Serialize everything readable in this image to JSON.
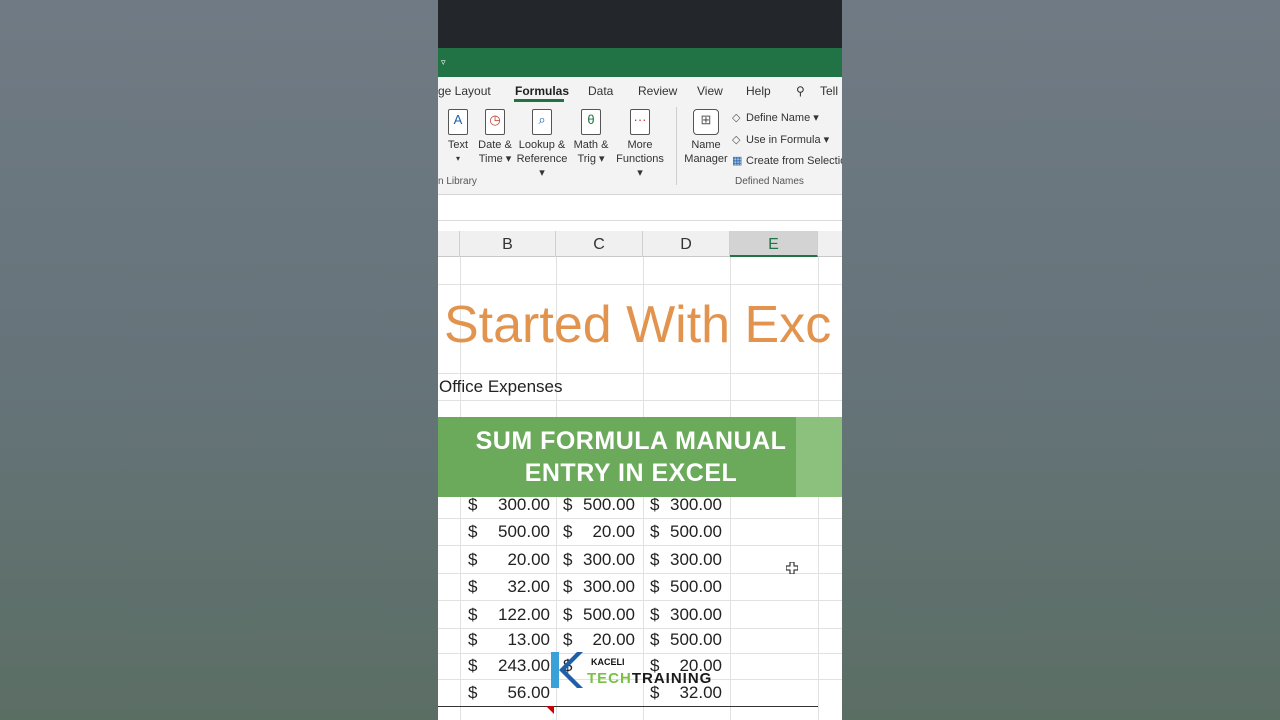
{
  "ribbon": {
    "tabs": [
      {
        "label": "ge Layout"
      },
      {
        "label": "Formulas"
      },
      {
        "label": "Data"
      },
      {
        "label": "Review"
      },
      {
        "label": "View"
      },
      {
        "label": "Help"
      }
    ],
    "tell_label": "Tell",
    "function_buttons": [
      {
        "line1": "Text",
        "line2": "▾",
        "glyph": "A"
      },
      {
        "line1": "Date &",
        "line2": "Time ▾",
        "glyph": "◷"
      },
      {
        "line1": "Lookup &",
        "line2": "Reference ▾",
        "glyph": "⌕"
      },
      {
        "line1": "Math &",
        "line2": "Trig ▾",
        "glyph": "θ"
      },
      {
        "line1": "More",
        "line2": "Functions ▾",
        "glyph": "···"
      }
    ],
    "name_manager": {
      "line1": "Name",
      "line2": "Manager"
    },
    "defined_names": {
      "define_name": "Define Name ▾",
      "use_in_formula": "Use in Formula ▾",
      "create_from_selection": "Create from Selectio"
    },
    "group_function_library": "n Library",
    "group_defined_names": "Defined Names"
  },
  "columns": [
    "B",
    "C",
    "D",
    "E"
  ],
  "sheet": {
    "heading": "Started With Exc",
    "subheading": "Office Expenses",
    "rows": [
      [
        "$",
        "300.00",
        "$",
        "500.00",
        "$",
        "300.00"
      ],
      [
        "$",
        "500.00",
        "$",
        "20.00",
        "$",
        "500.00"
      ],
      [
        "$",
        "20.00",
        "$",
        "300.00",
        "$",
        "300.00"
      ],
      [
        "$",
        "32.00",
        "$",
        "300.00",
        "$",
        "500.00"
      ],
      [
        "$",
        "122.00",
        "$",
        "500.00",
        "$",
        "300.00"
      ],
      [
        "$",
        "13.00",
        "$",
        "20.00",
        "$",
        "500.00"
      ],
      [
        "$",
        "243.00",
        "$",
        "",
        "$",
        "20.00"
      ],
      [
        "$",
        "56.00",
        "",
        "",
        "$",
        "32.00"
      ]
    ]
  },
  "banner": {
    "line1": "SUM FORMULA MANUAL",
    "line2": "ENTRY IN EXCEL"
  },
  "logo": {
    "small": "KACELI",
    "tech": "TECH",
    "training": "TRAINING"
  },
  "colors": {
    "excel_green": "#217346",
    "banner_green": "#6aaa5a",
    "heading_orange": "#e2944e"
  }
}
